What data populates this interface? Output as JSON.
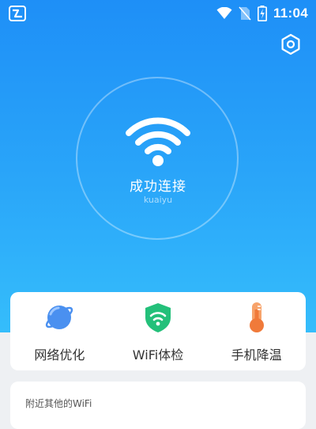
{
  "status_bar": {
    "time": "11:04",
    "icons": [
      "app-icon",
      "wifi-signal-icon",
      "no-sim-icon",
      "battery-charging-icon"
    ]
  },
  "header": {
    "settings_icon": "gear-icon"
  },
  "connection": {
    "status": "成功连接",
    "ssid": "kuaiyu",
    "icon": "wifi-icon"
  },
  "tools": [
    {
      "label": "网络优化",
      "icon": "planet-icon",
      "color": "#4a90f0"
    },
    {
      "label": "WiFi体检",
      "icon": "shield-wifi-icon",
      "color": "#23c07a"
    },
    {
      "label": "手机降温",
      "icon": "thermometer-icon",
      "color": "#f07a3a"
    }
  ],
  "nearby": {
    "title": "附近其他的WiFi"
  },
  "colors": {
    "hero_top": "#1e8ff7",
    "hero_bottom": "#35bdfb",
    "background": "#eef0f3"
  }
}
